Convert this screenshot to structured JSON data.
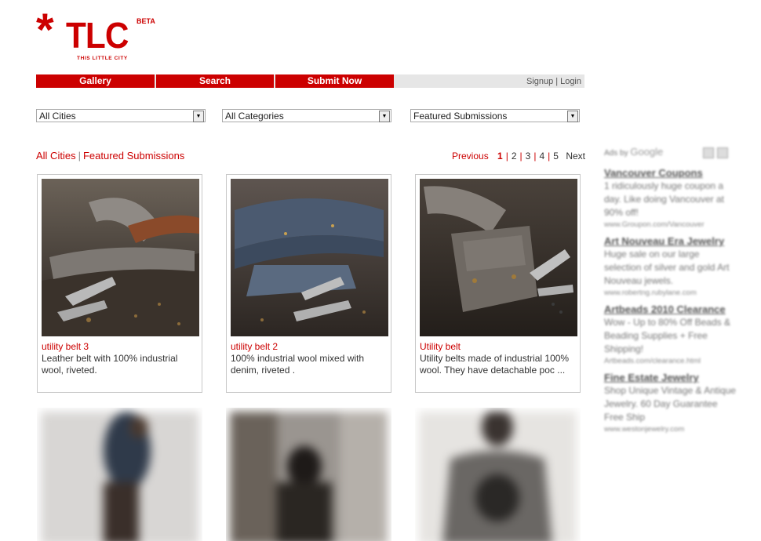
{
  "logo": {
    "star": "*",
    "word": "TLC",
    "beta": "BETA",
    "tagline": "THIS LITTLE CITY"
  },
  "nav": {
    "tabs": [
      "Gallery",
      "Search",
      "Submit Now"
    ],
    "signup": "Signup",
    "separator": "|",
    "login": "Login"
  },
  "filters": {
    "city": "All Cities",
    "category": "All Categories",
    "sort": "Featured Submissions"
  },
  "breadcrumb": {
    "city": "All Cities",
    "separator": "|",
    "section": "Featured Submissions"
  },
  "pager": {
    "previous": "Previous",
    "pages": [
      "1",
      "2",
      "3",
      "4",
      "5"
    ],
    "current": "1",
    "next": "Next",
    "separator": "|"
  },
  "cards": [
    {
      "title": "utility belt 3",
      "desc": "Leather belt with 100% industrial wool, riveted."
    },
    {
      "title": "utility belt 2",
      "desc": "100% industrial wool mixed with denim, riveted ."
    },
    {
      "title": "Utility belt",
      "desc": "Utility belts made of industrial 100% wool. They have detachable poc ..."
    }
  ],
  "ads": {
    "label": "Ads by",
    "brand": "Google",
    "items": [
      {
        "headline": "Vancouver Coupons",
        "body": "1 ridiculously huge coupon a day. Like doing Vancouver at 90% off!",
        "url": "www.Groupon.com/Vancouver"
      },
      {
        "headline": "Art Nouveau Era Jewelry",
        "body": "Huge sale on our large selection of silver and gold Art Nouveau jewels.",
        "url": "www.robertng.rubylane.com"
      },
      {
        "headline": "Artbeads 2010 Clearance",
        "body": "Wow - Up to 80% Off Beads & Beading Supplies + Free Shipping!",
        "url": "Artbeads.com/clearance.html"
      },
      {
        "headline": "Fine Estate Jewelry",
        "body": "Shop Unique Vintage & Antique Jewelry. 60 Day Guarantee Free Ship",
        "url": "www.westonjewelry.com"
      }
    ]
  }
}
